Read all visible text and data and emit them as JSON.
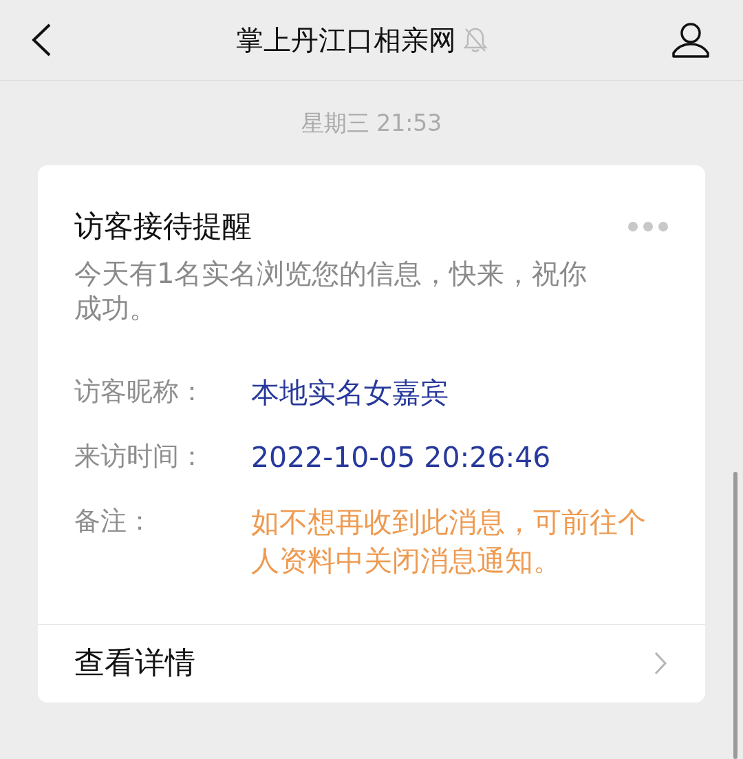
{
  "header": {
    "title": "掌上丹江口相亲网",
    "muted": true
  },
  "timestamp": "星期三 21:53",
  "card": {
    "title": "访客接待提醒",
    "description": "今天有1名实名浏览您的信息，快来，祝你成功。",
    "fields": [
      {
        "label": "访客昵称：",
        "value": "本地实名女嘉宾",
        "kind": "info"
      },
      {
        "label": "来访时间：",
        "value": "2022-10-05 20:26:46",
        "kind": "info"
      },
      {
        "label": "备注：",
        "value": "如不想再收到此消息，可前往个人资料中关闭消息通知。",
        "kind": "note"
      }
    ],
    "link": "查看详情"
  }
}
